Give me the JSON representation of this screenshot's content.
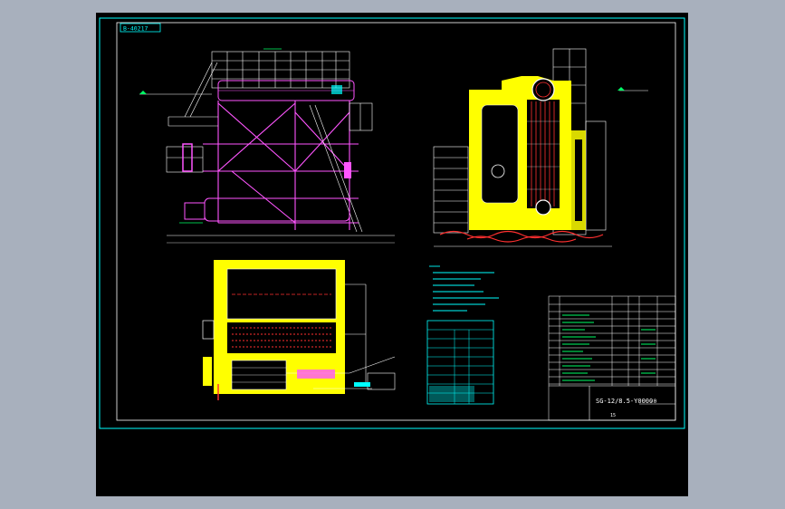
{
  "drawing": {
    "corner_tag": "B-40217",
    "title_block_code": "SG-12/8.5-Y0000",
    "title_block_suffix": "-0",
    "sheet_number": "15",
    "colors": {
      "background": "#000000",
      "outer_frame": "#00ffff",
      "structure": "#ff55ff",
      "linework": "#ffffff",
      "casing": "#ffff00",
      "tubes": "#ff3030",
      "dimension": "#00ff66",
      "notes": "#00ffff",
      "accent": "#00aaff"
    }
  }
}
